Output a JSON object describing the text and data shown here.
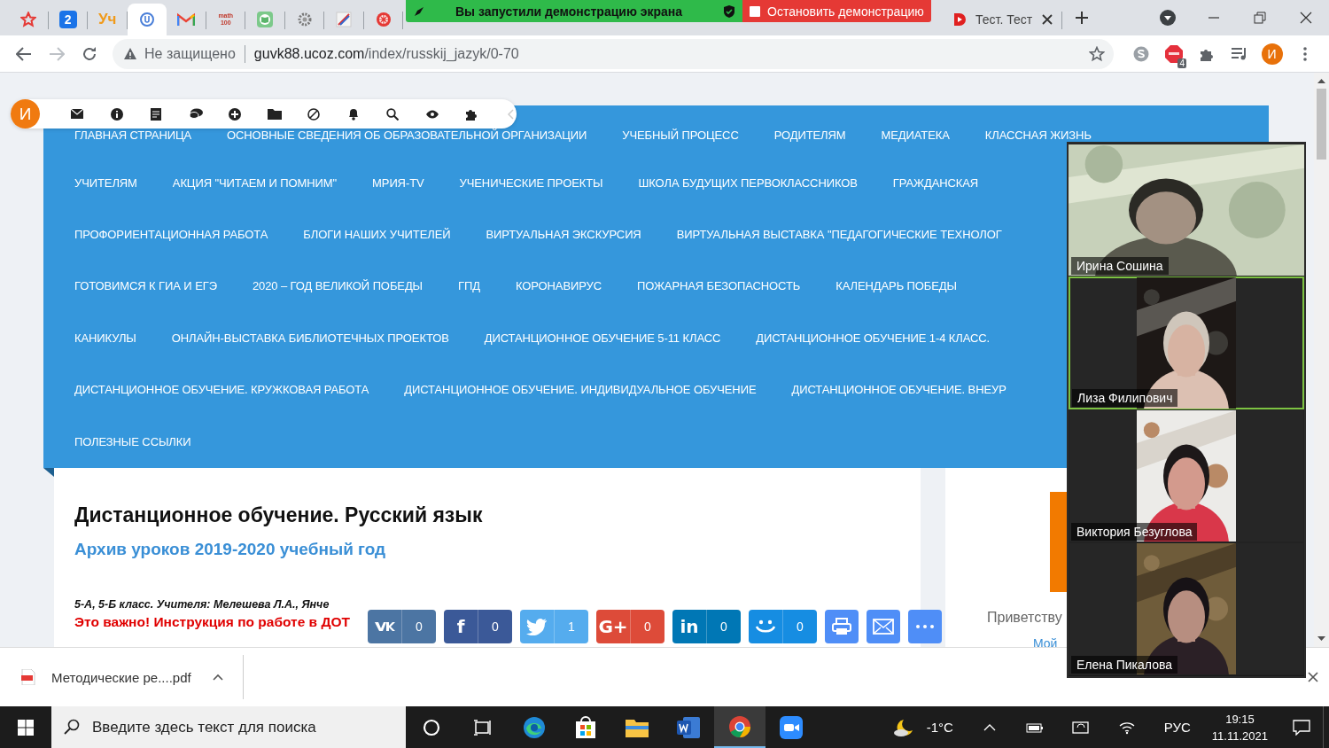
{
  "browser": {
    "tabs": [
      {
        "kind": "star",
        "selected": false
      },
      {
        "kind": "number",
        "text": "2",
        "selected": false
      },
      {
        "kind": "letters",
        "text": "Уч",
        "selected": false
      },
      {
        "kind": "ring",
        "selected": true
      },
      {
        "kind": "gmail",
        "selected": false
      },
      {
        "kind": "math",
        "text": "math",
        "subtext": "100",
        "selected": false
      },
      {
        "kind": "book",
        "selected": false
      },
      {
        "kind": "gear",
        "selected": false
      },
      {
        "kind": "flag",
        "selected": false
      },
      {
        "kind": "wheel",
        "selected": false
      },
      {
        "kind": "titled",
        "title": "Тест. Тест",
        "selected": false
      }
    ],
    "address": {
      "security": "Не защищено",
      "host": "guvk88.ucoz.com",
      "path": "/index/russkij_jazyk/0-70"
    },
    "extensions": [
      {
        "kind": "skype"
      },
      {
        "kind": "abp",
        "badge": "4"
      },
      {
        "kind": "puzzle"
      },
      {
        "kind": "media"
      }
    ],
    "profile": "И"
  },
  "screen_share": {
    "message": "Вы запустили демонстрацию экрана",
    "stop": "Остановить демонстрацию"
  },
  "admin_bar": {
    "avatar": "И",
    "tools": [
      {
        "kind": "mail"
      },
      {
        "kind": "info"
      },
      {
        "kind": "note"
      },
      {
        "kind": "chat"
      },
      {
        "kind": "plus"
      },
      {
        "kind": "folder"
      },
      {
        "kind": "ban"
      },
      {
        "kind": "bell"
      },
      {
        "kind": "search"
      },
      {
        "kind": "eye"
      },
      {
        "kind": "puzzle"
      },
      {
        "kind": "collapse"
      }
    ]
  },
  "menu": {
    "lines": [
      {
        "links": [
          "ГЛАВНАЯ СТРАНИЦА",
          "ОСНОВНЫЕ СВЕДЕНИЯ ОБ ОБРАЗОВАТЕЛЬНОЙ ОРГАНИЗАЦИИ",
          "УЧЕБНЫЙ ПРОЦЕСС",
          "РОДИТЕЛЯМ",
          "МЕДИАТЕКА",
          "КЛАССНАЯ ЖИЗНЬ"
        ]
      },
      {
        "links": [
          "УЧИТЕЛЯМ",
          "АКЦИЯ \"ЧИТАЕМ И ПОМНИМ\"",
          "МРИЯ-TV",
          "УЧЕНИЧЕСКИЕ ПРОЕКТЫ",
          "ШКОЛА БУДУЩИХ ПЕРВОКЛАССНИКОВ",
          "ГРАЖДАНСКАЯ"
        ]
      },
      {
        "links": [
          "ПРОФОРИЕНТАЦИОННАЯ РАБОТА",
          "БЛОГИ НАШИХ УЧИТЕЛЕЙ",
          "ВИРТУАЛЬНАЯ ЭКСКУРСИЯ",
          "ВИРТУАЛЬНАЯ ВЫСТАВКА \"ПЕДАГОГИЧЕСКИЕ ТЕХНОЛОГ"
        ]
      },
      {
        "links": [
          "ГОТОВИМСЯ К ГИА И ЕГЭ",
          "2020 – ГОД ВЕЛИКОЙ ПОБЕДЫ",
          "ГПД",
          "КОРОНАВИРУС",
          "ПОЖАРНАЯ БЕЗОПАСНОСТЬ",
          "КАЛЕНДАРЬ ПОБЕДЫ"
        ]
      },
      {
        "links": [
          "КАНИКУЛЫ",
          "ОНЛАЙН-ВЫСТАВКА БИБЛИОТЕЧНЫХ ПРОЕКТОВ",
          "ДИСТАНЦИОННОЕ ОБУЧЕНИЕ 5-11 КЛАСС",
          "ДИСТАНЦИОННОЕ ОБУЧЕНИЕ 1-4 КЛАСС."
        ]
      },
      {
        "links": [
          "ДИСТАНЦИОННОЕ ОБУЧЕНИЕ. КРУЖКОВАЯ РАБОТА",
          "ДИСТАНЦИОННОЕ ОБУЧЕНИЕ. ИНДИВИДУАЛЬНОЕ ОБУЧЕНИЕ",
          "ДИСТАНЦИОННОЕ ОБУЧЕНИЕ. ВНЕУР"
        ]
      },
      {
        "links": [
          "ПОЛЕЗНЫЕ ССЫЛКИ"
        ]
      }
    ]
  },
  "article": {
    "title": "Дистанционное обучение. Русский язык",
    "link": "Архив уроков 2019-2020 учебный год",
    "teachers": "5-А, 5-Б класс. Учителя: Мелешева Л.А., Янче",
    "notice": "Это важно! Инструкция по работе в ДОТ"
  },
  "share": [
    {
      "kind": "vk",
      "count": "0"
    },
    {
      "kind": "facebook",
      "glyph": "f",
      "count": "0"
    },
    {
      "kind": "twitter",
      "count": "1"
    },
    {
      "kind": "gplus",
      "glyph": "G+",
      "count": "0"
    },
    {
      "kind": "linkedin",
      "glyph": "in",
      "count": "0"
    },
    {
      "kind": "moimir",
      "count": "0"
    },
    {
      "kind": "print"
    },
    {
      "kind": "mail"
    },
    {
      "kind": "more"
    }
  ],
  "sidebar": {
    "greeting": "Приветству",
    "link": "Мой"
  },
  "video_panel": {
    "participants": [
      {
        "name": "Ирина Сошина",
        "speaking": false
      },
      {
        "name": "Лиза Филипович",
        "speaking": true
      },
      {
        "name": "Виктория Безуглова",
        "speaking": false
      },
      {
        "name": "Елена Пикалова",
        "speaking": false
      }
    ]
  },
  "downloads": {
    "file": "Методические ре....pdf"
  },
  "taskbar": {
    "search_placeholder": "Введите здесь текст для поиска",
    "apps": [
      {
        "kind": "cortana",
        "active": false
      },
      {
        "kind": "taskview",
        "active": false
      },
      {
        "kind": "edge",
        "active": false
      },
      {
        "kind": "store",
        "active": false
      },
      {
        "kind": "explorer",
        "active": false
      },
      {
        "kind": "word",
        "active": false
      },
      {
        "kind": "chrome",
        "active": true
      },
      {
        "kind": "zoom",
        "active": false
      }
    ],
    "temperature": "-1°C",
    "language": "РУС",
    "time": "19:15",
    "date": "11.11.2021"
  }
}
